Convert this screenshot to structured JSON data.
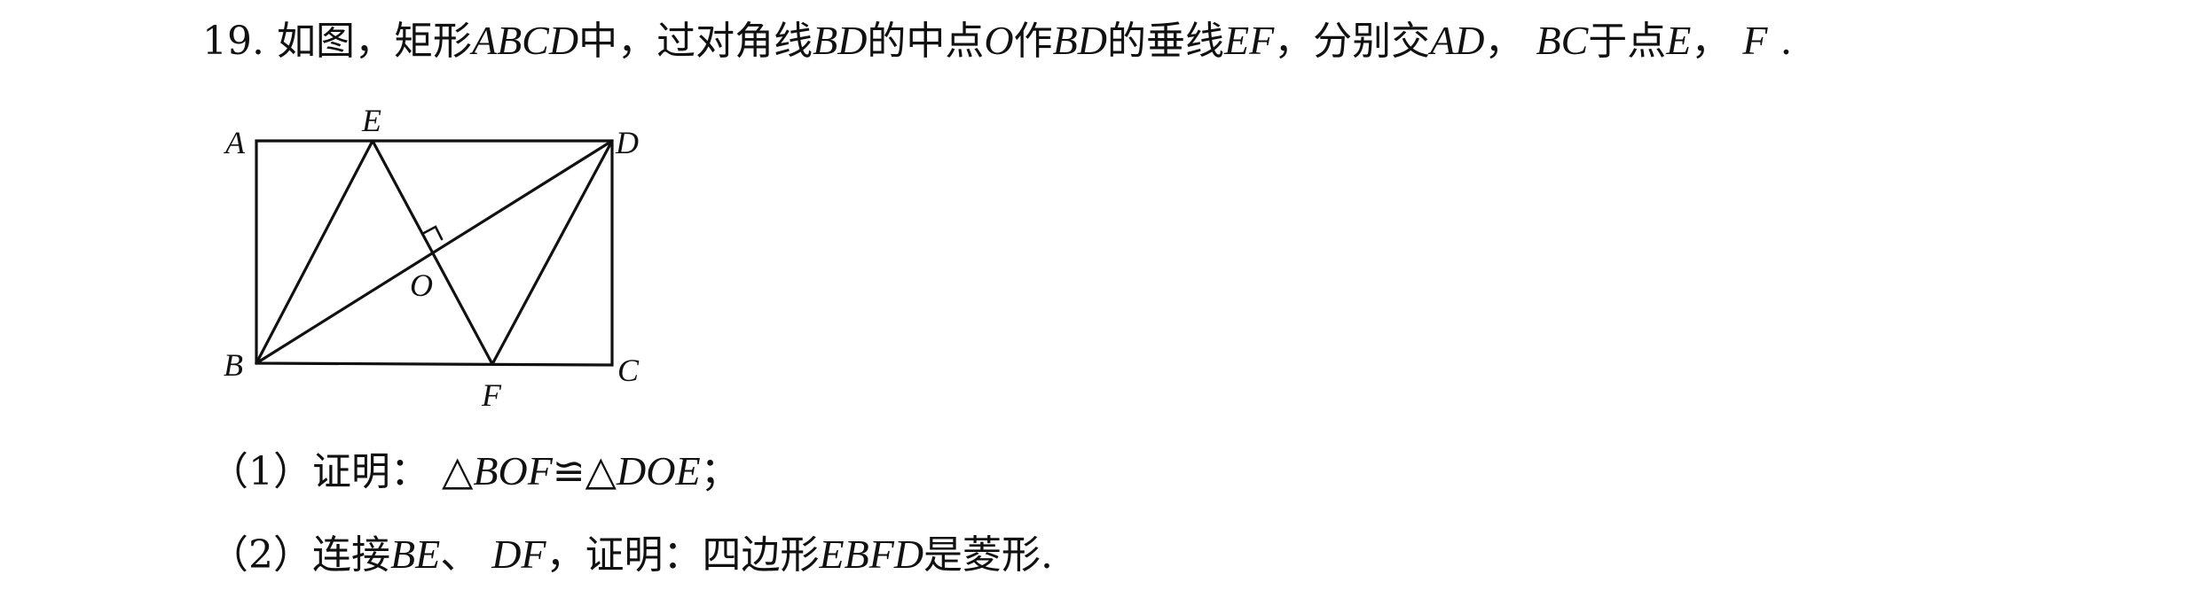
{
  "problem": {
    "number": "19.",
    "intro_1": "如图，矩形",
    "rect_name": "ABCD",
    "intro_2": "中，过对角线",
    "diag_1": "BD",
    "intro_3": "的中点",
    "mid": "O",
    "intro_4": "作",
    "diag_2": "BD",
    "intro_5": "的垂线",
    "perp": "EF",
    "intro_6": "，分别交",
    "side_1": "AD",
    "comma_1": "，",
    "side_2": "BC",
    "intro_7": "于点",
    "pt_1": "E",
    "comma_2": "，",
    "pt_2": "F",
    "end": "."
  },
  "figure": {
    "labels": {
      "A": "A",
      "B": "B",
      "C": "C",
      "D": "D",
      "E": "E",
      "F": "F",
      "O": "O"
    }
  },
  "part1": {
    "prefix": "（1）证明：",
    "tri_1": "△BOF",
    "congruent": "≌",
    "tri_2": "△DOE",
    "end": "；"
  },
  "part2": {
    "prefix": "（2）连接",
    "seg_1": "BE",
    "sep": "、",
    "seg_2": "DF",
    "mid_text": "，证明：四边形",
    "quad": "EBFD",
    "end": "是菱形."
  }
}
